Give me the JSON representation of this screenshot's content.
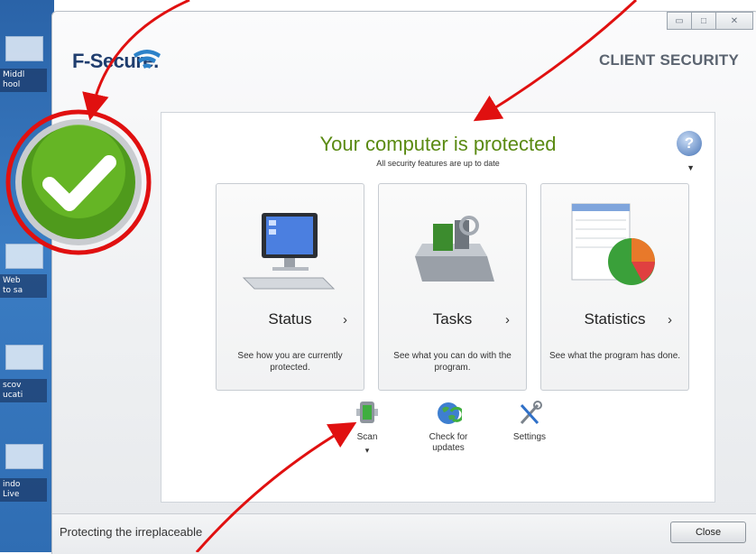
{
  "desktop": {
    "labels": [
      "Middl\nhool",
      "Web\n to sa",
      "scov\nucati",
      "indo\n Live"
    ]
  },
  "window": {
    "brand": "F-Secure.",
    "product": "CLIENT SECURITY",
    "controls": {
      "minimize": "▭",
      "maximize": "□",
      "close": "✕"
    }
  },
  "status": {
    "headline": "Your computer is protected",
    "subline": "All security features are up to date",
    "help_icon": "help-icon"
  },
  "cards": [
    {
      "title": "Status",
      "desc": "See how you are currently protected.",
      "chevron": "›"
    },
    {
      "title": "Tasks",
      "desc": "See what you can do with the program.",
      "chevron": "›"
    },
    {
      "title": "Statistics",
      "desc": "See what the program has done.",
      "chevron": "›"
    }
  ],
  "tools": [
    {
      "label": "Scan",
      "icon": "scan-icon",
      "dropdown": "▾"
    },
    {
      "label": "Check for\nupdates",
      "icon": "globe-update-icon"
    },
    {
      "label": "Settings",
      "icon": "settings-tools-icon"
    }
  ],
  "footer": {
    "tagline": "Protecting the irreplaceable",
    "close_label": "Close"
  },
  "colors": {
    "accent_green": "#5a8a12",
    "annotation_red": "#e01010",
    "brand_blue": "#1f3d6e"
  }
}
